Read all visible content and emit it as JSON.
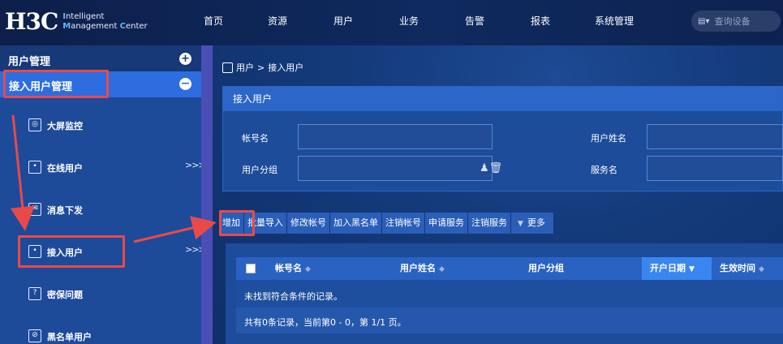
{
  "app": {
    "logo_mark": "H3C",
    "logo_line1_accent": "I",
    "logo_line1": "ntelligent",
    "logo_line2_accent1": "M",
    "logo_line2a": "anagement ",
    "logo_line2_accent2": "C",
    "logo_line2b": "enter"
  },
  "nav": [
    "首页",
    "资源",
    "用户",
    "业务",
    "告警",
    "报表",
    "系统管理"
  ],
  "search": {
    "placeholder": "查询设备",
    "icon": "device-search-icon"
  },
  "sidebar": {
    "header": "用户管理",
    "group": "接入用户管理",
    "items": [
      {
        "label": "大屏监控",
        "icon": "monitor-icon",
        "has_children": false
      },
      {
        "label": "在线用户",
        "icon": "online-user-icon",
        "has_children": true,
        "chevron": ">>>"
      },
      {
        "label": "消息下发",
        "icon": "message-icon",
        "has_children": false
      },
      {
        "label": "接入用户",
        "icon": "access-user-icon",
        "has_children": true,
        "chevron": ">>>"
      },
      {
        "label": "密保问题",
        "icon": "security-question-icon",
        "has_children": false
      },
      {
        "label": "黑名单用户",
        "icon": "blacklist-icon",
        "has_children": false
      }
    ]
  },
  "breadcrumb": {
    "root": "用户",
    "sep": ">",
    "current": "接入用户"
  },
  "panel": {
    "title": "接入用户",
    "fields": {
      "account": {
        "label": "帐号名",
        "value": ""
      },
      "user_name": {
        "label": "用户姓名",
        "value": ""
      },
      "user_group": {
        "label": "用户分组",
        "value": ""
      },
      "service": {
        "label": "服务名",
        "value": ""
      }
    }
  },
  "toolbar": {
    "buttons": [
      "增加",
      "批量导入",
      "修改帐号",
      "加入黑名单",
      "注销帐号",
      "申请服务",
      "注销服务"
    ],
    "more": "更多"
  },
  "grid": {
    "columns": [
      "帐号名",
      "用户姓名",
      "用户分组",
      "开户日期",
      "生效时间"
    ],
    "sorted_column": "开户日期",
    "empty_text": "未找到符合条件的记录。",
    "footer": "共有0条记录，当前第0 - 0，第 1/1 页。"
  },
  "colors": {
    "topbar": "#0f2a5f",
    "sidebar": "#1e4a9a",
    "sidebar_active": "#2d6de0",
    "accent": "#3a86f0",
    "annotation": "#e84a4a"
  }
}
